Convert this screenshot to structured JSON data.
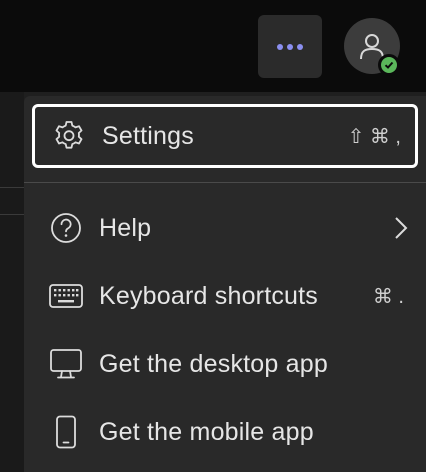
{
  "topbar": {
    "more_icon": "more-horizontal-icon",
    "avatar_icon": "person-icon",
    "presence_icon": "checkmark-icon",
    "presence_color": "#5bb75b",
    "accent": "#8b8ff0"
  },
  "menu": {
    "items": [
      {
        "label": "Settings",
        "icon": "gear-icon",
        "shortcut": "⇧ ⌘ ,"
      },
      {
        "label": "Help",
        "icon": "question-circle-icon",
        "shortcut": ""
      },
      {
        "label": "Keyboard shortcuts",
        "icon": "keyboard-icon",
        "shortcut": "⌘ ."
      },
      {
        "label": "Get the desktop app",
        "icon": "desktop-icon",
        "shortcut": ""
      },
      {
        "label": "Get the mobile app",
        "icon": "phone-icon",
        "shortcut": ""
      }
    ]
  }
}
